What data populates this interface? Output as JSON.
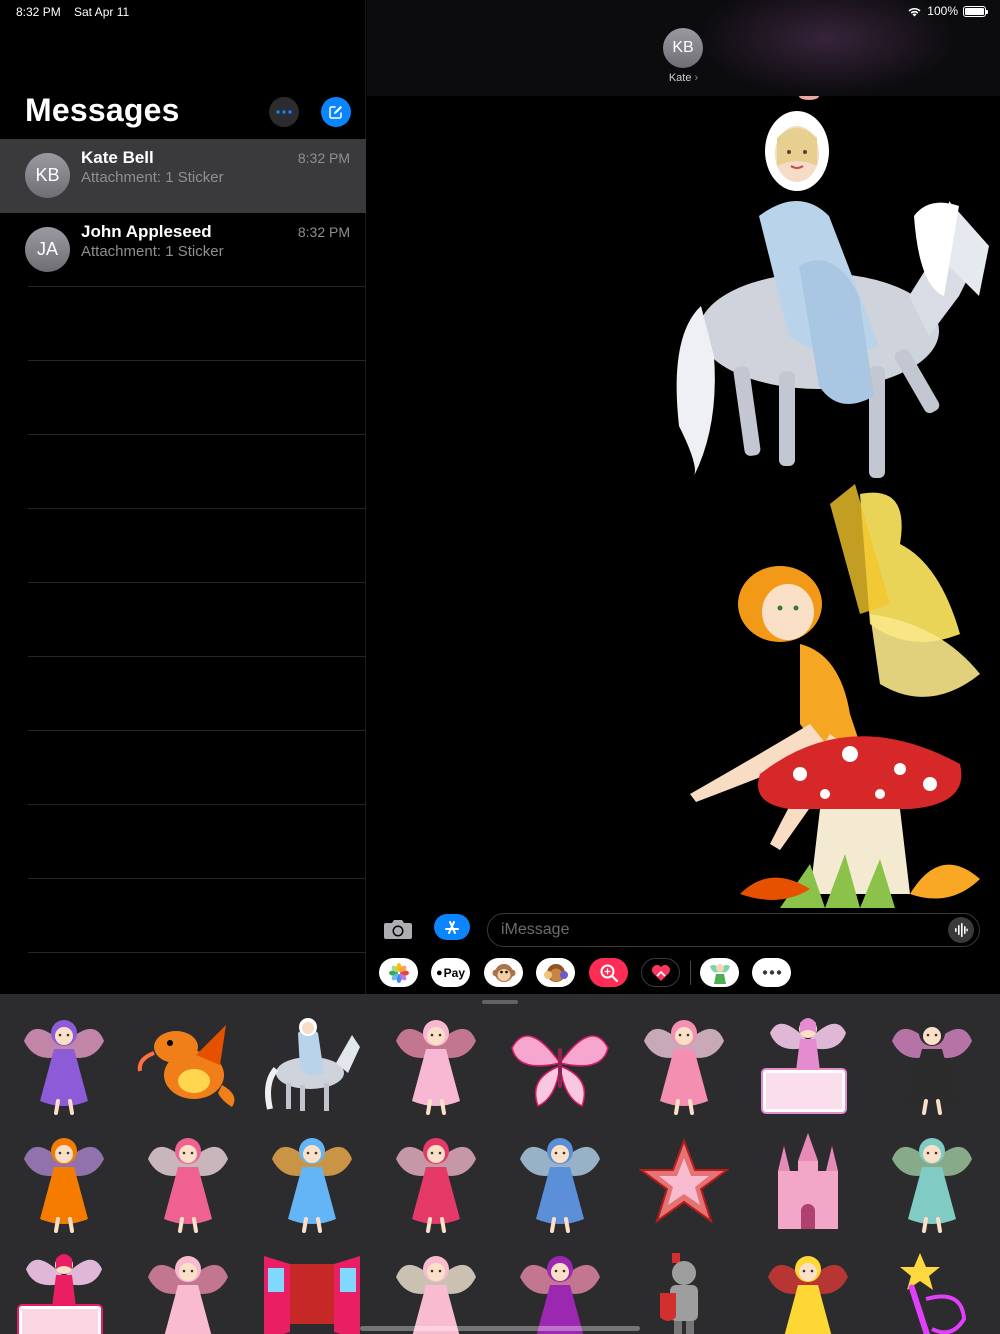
{
  "status_bar": {
    "time": "8:32 PM",
    "date": "Sat Apr 11",
    "battery": "100%",
    "battery_level": 1.0
  },
  "sidebar": {
    "title": "Messages",
    "conversations": [
      {
        "initials": "KB",
        "name": "Kate Bell",
        "preview": "Attachment: 1 Sticker",
        "time": "8:32 PM",
        "selected": true
      },
      {
        "initials": "JA",
        "name": "John Appleseed",
        "preview": "Attachment: 1 Sticker",
        "time": "8:32 PM",
        "selected": false
      }
    ]
  },
  "conversation": {
    "contact_initials": "KB",
    "contact_name": "Kate",
    "messages": [
      {
        "type": "sticker",
        "sticker": "princess-on-horse"
      },
      {
        "type": "sticker",
        "sticker": "fairy-on-mushroom"
      }
    ]
  },
  "composer": {
    "placeholder": "iMessage",
    "value": ""
  },
  "app_strip": {
    "items": [
      "photos-icon",
      "apple-pay-icon",
      "animoji-icon",
      "memoji-icon",
      "image-search-icon",
      "digital-touch-icon",
      "fairy-sticker-app-icon",
      "more-apps-icon"
    ],
    "apple_pay_label": "Pay"
  },
  "sticker_drawer": {
    "stickers": [
      "purple-fairy",
      "orange-dragon",
      "princess-on-horse",
      "pink-gown",
      "pink-butterfly",
      "pink-sitting-fairy",
      "fairy-with-sign",
      "black-pink-fairy",
      "orange-haired-fairy",
      "ballerina-fairy",
      "blue-angel",
      "red-dress-princess",
      "blue-dress-princess",
      "pink-star",
      "pink-castle",
      "green-fairy",
      "fairy-with-bunny",
      "pink-princess",
      "pink-window",
      "tutu-fairy",
      "purple-haired-fairy",
      "knight",
      "yellow-fairy",
      "magic-wand"
    ]
  }
}
